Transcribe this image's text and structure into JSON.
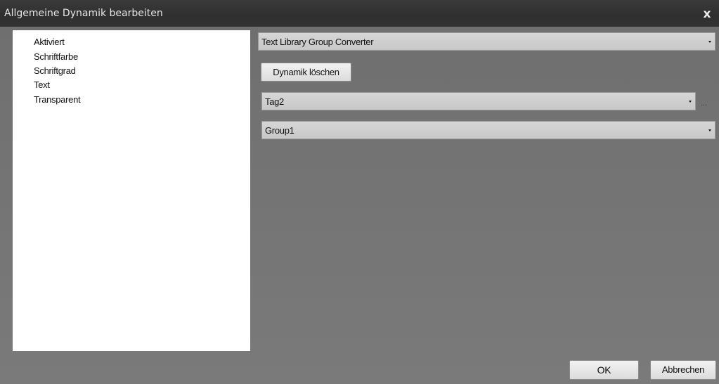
{
  "window": {
    "title": "Allgemeine Dynamik bearbeiten",
    "close_glyph": "x"
  },
  "tree": {
    "items": [
      {
        "label": "Aktiviert"
      },
      {
        "label": "Schriftfarbe"
      },
      {
        "label": "Schriftgrad"
      },
      {
        "label": "Text"
      },
      {
        "label": "Transparent"
      }
    ]
  },
  "converter": {
    "selected": "Text Library Group Converter"
  },
  "delete_button": {
    "label": "Dynamik löschen"
  },
  "tag_combo": {
    "selected": "Tag2",
    "browse_label": "..."
  },
  "group_combo": {
    "selected": "Group1"
  },
  "footer": {
    "ok_label": "OK",
    "cancel_label": "Abbrechen"
  }
}
